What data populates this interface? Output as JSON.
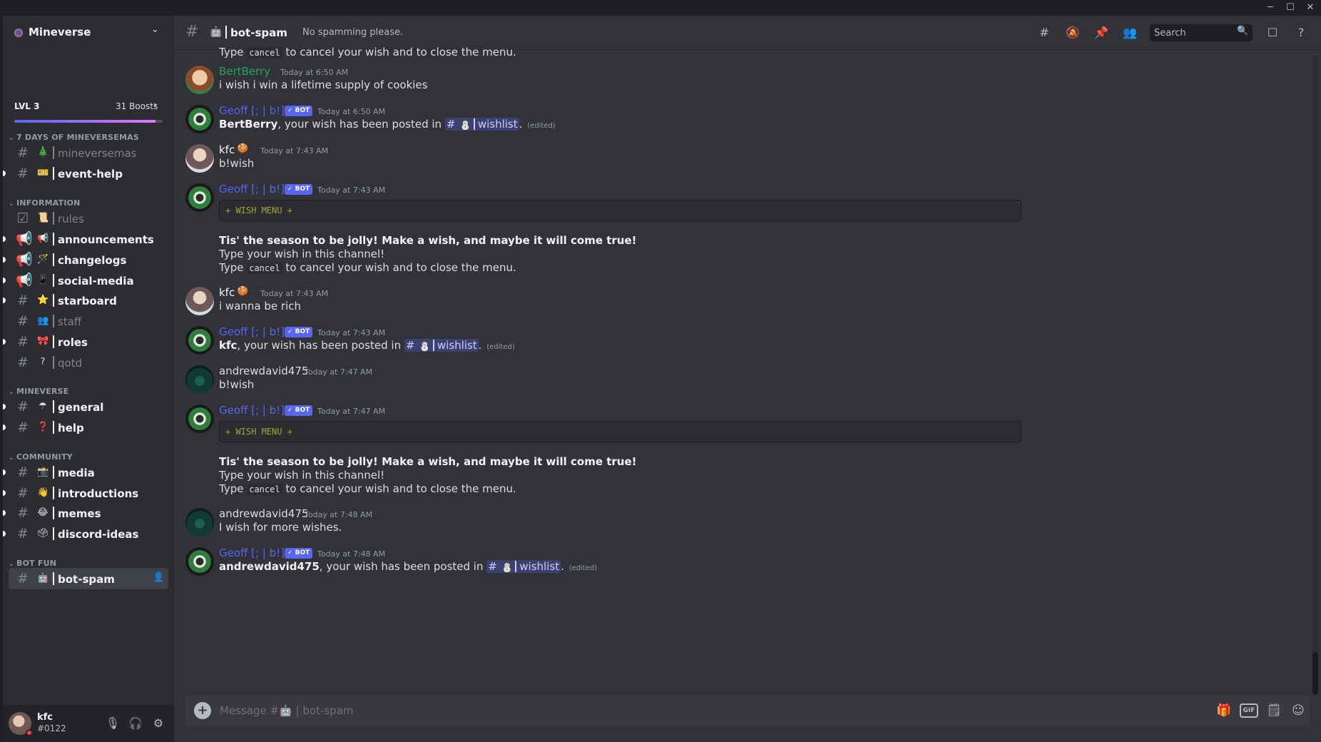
{
  "window": {
    "minimize": "─",
    "maximize": "☐",
    "close": "✕"
  },
  "server": {
    "name": "Mineverse",
    "level": "LVL 3",
    "boosts": "31 Boosts",
    "boost_progress": 0.95
  },
  "categories": [
    {
      "name": "7 DAYS OF MINEVERSEMAS",
      "channels": [
        {
          "icon": "#",
          "emoji": "🎄",
          "name": "mineversemas",
          "bright": false,
          "unread": false
        },
        {
          "icon": "#",
          "emoji": "🎫",
          "name": "event-help",
          "bright": true,
          "unread": true
        }
      ]
    },
    {
      "name": "INFORMATION",
      "channels": [
        {
          "icon": "☑",
          "emoji": "📜",
          "name": "rules",
          "bright": false,
          "unread": false
        },
        {
          "icon": "📢",
          "emoji": "📢",
          "name": "announcements",
          "bright": true,
          "unread": true
        },
        {
          "icon": "📢",
          "emoji": "🪄",
          "name": "changelogs",
          "bright": true,
          "unread": true
        },
        {
          "icon": "📢",
          "emoji": "📱",
          "name": "social-media",
          "bright": true,
          "unread": true
        },
        {
          "icon": "#",
          "emoji": "⭐",
          "name": "starboard",
          "bright": true,
          "unread": true
        },
        {
          "icon": "#",
          "emoji": "👥",
          "name": "staff",
          "bright": false,
          "unread": false
        },
        {
          "icon": "#",
          "emoji": "🎀",
          "name": "roles",
          "bright": true,
          "unread": true
        },
        {
          "icon": "#",
          "emoji": "?",
          "name": "qotd",
          "bright": false,
          "unread": false
        }
      ]
    },
    {
      "name": "MINEVERSE",
      "channels": [
        {
          "icon": "#",
          "emoji": "☂",
          "name": "general",
          "bright": true,
          "unread": true
        },
        {
          "icon": "#",
          "emoji": "❓",
          "name": "help",
          "bright": true,
          "unread": true
        }
      ]
    },
    {
      "name": "COMMUNITY",
      "channels": [
        {
          "icon": "#",
          "emoji": "📸",
          "name": "media",
          "bright": true,
          "unread": true
        },
        {
          "icon": "#",
          "emoji": "👋",
          "name": "introductions",
          "bright": true,
          "unread": true
        },
        {
          "icon": "#",
          "emoji": "😂",
          "name": "memes",
          "bright": true,
          "unread": true
        },
        {
          "icon": "#",
          "emoji": "🗳",
          "name": "discord-ideas",
          "bright": true,
          "unread": true
        }
      ]
    },
    {
      "name": "BOT FUN",
      "channels": [
        {
          "icon": "#",
          "emoji": "🤖",
          "name": "bot-spam",
          "bright": true,
          "unread": false,
          "active": true
        }
      ]
    }
  ],
  "user": {
    "name": "kfc",
    "tag": "#0122"
  },
  "channel_header": {
    "emoji": "🤖",
    "name": "bot-spam",
    "topic": "No spamming please.",
    "search_placeholder": "Search"
  },
  "messages": {
    "top_fragment": {
      "pre": "Type",
      "code": "cancel",
      "post": "to cancel your wish and to close the menu."
    },
    "m1": {
      "author": "BertBerry",
      "author_color": "#23a55a",
      "time": "Today at 6:50 AM",
      "text": "i wish i win a lifetime supply of cookies"
    },
    "m2": {
      "author": "Geoff [; | b!]",
      "author_color": "#5865f2",
      "badge": "✓ BOT",
      "time": "Today at 6:50 AM",
      "target": "BertBerry",
      "text": ", your wish has been posted in",
      "channel": "wishlist",
      "edited": "(edited)"
    },
    "m3": {
      "author": "kfc",
      "author_color": "#f2f3f5",
      "emoji": "🍪",
      "time": "Today at 7:43 AM",
      "text": "b!wish"
    },
    "m4": {
      "author": "Geoff [; | b!]",
      "author_color": "#5865f2",
      "badge": "✓ BOT",
      "time": "Today at 7:43 AM",
      "code": "+ WISH MENU +",
      "line1": "Tis' the season to be jolly! Make a wish, and maybe it will come true!",
      "line2": "Type your wish in this channel!",
      "line3_pre": "Type",
      "line3_code": "cancel",
      "line3_post": "to cancel your wish and to close the menu."
    },
    "m5": {
      "author": "kfc",
      "author_color": "#f2f3f5",
      "emoji": "🍪",
      "time": "Today at 7:43 AM",
      "text": "i wanna be rich"
    },
    "m6": {
      "author": "Geoff [; | b!]",
      "author_color": "#5865f2",
      "badge": "✓ BOT",
      "time": "Today at 7:43 AM",
      "target": "kfc",
      "text": ", your wish has been posted in",
      "channel": "wishlist",
      "edited": "(edited)"
    },
    "m7": {
      "author": "andrewdavid475",
      "author_color": "#dbdee1",
      "time": "Today at 7:47 AM",
      "text": "b!wish"
    },
    "m8": {
      "author": "Geoff [; | b!]",
      "author_color": "#5865f2",
      "badge": "✓ BOT",
      "time": "Today at 7:47 AM",
      "code": "+ WISH MENU +",
      "line1": "Tis' the season to be jolly! Make a wish, and maybe it will come true!",
      "line2": "Type your wish in this channel!",
      "line3_pre": "Type",
      "line3_code": "cancel",
      "line3_post": "to cancel your wish and to close the menu."
    },
    "m9": {
      "author": "andrewdavid475",
      "author_color": "#dbdee1",
      "time": "Today at 7:48 AM",
      "text": "I wish for more wishes."
    },
    "m10": {
      "author": "Geoff [; | b!]",
      "author_color": "#5865f2",
      "badge": "✓ BOT",
      "time": "Today at 7:48 AM",
      "target": "andrewdavid475",
      "text": ", your wish has been posted in",
      "channel": "wishlist",
      "edited": "(edited)"
    }
  },
  "composer": {
    "placeholder": "Message #🤖 | bot-spam",
    "gif": "GIF"
  },
  "colors": {
    "accent": "#5865f2",
    "bg": "#313338",
    "sidebar": "#2b2d31"
  }
}
